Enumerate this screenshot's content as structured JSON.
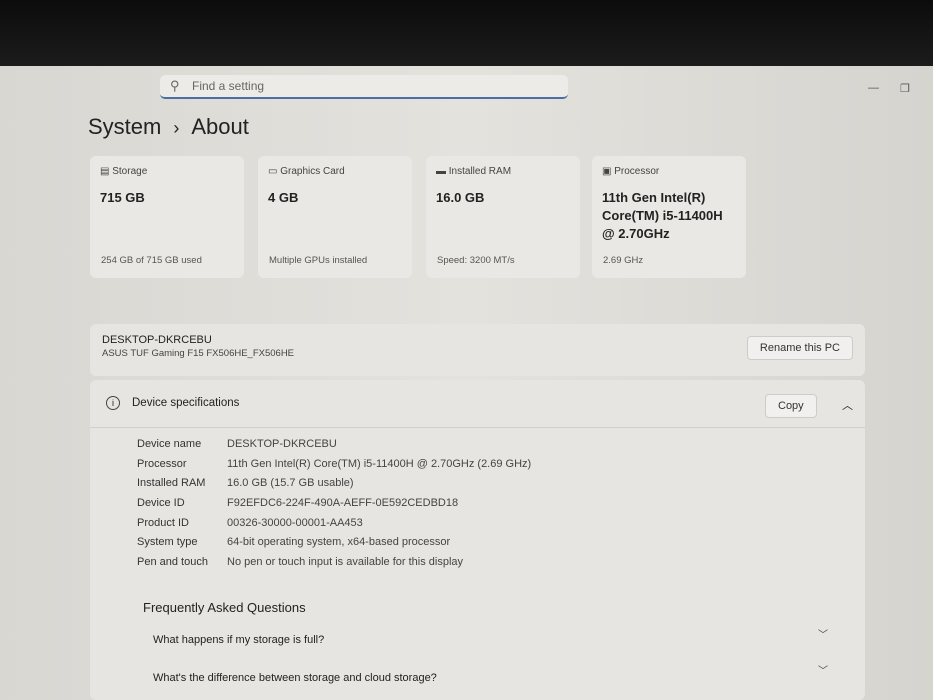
{
  "search": {
    "placeholder": "Find a setting"
  },
  "breadcrumb": {
    "parent": "System",
    "separator": "›",
    "current": "About"
  },
  "cards": [
    {
      "label": "Storage",
      "value": "715 GB",
      "sub": "254 GB of 715 GB used",
      "icon": "storage-icon"
    },
    {
      "label": "Graphics Card",
      "value": "4 GB",
      "sub": "Multiple GPUs installed",
      "icon": "gpu-icon"
    },
    {
      "label": "Installed RAM",
      "value": "16.0 GB",
      "sub": "Speed: 3200 MT/s",
      "icon": "ram-icon"
    },
    {
      "label": "Processor",
      "value": "11th Gen Intel(R) Core(TM) i5-11400H @ 2.70GHz",
      "sub": "2.69 GHz",
      "icon": "cpu-icon"
    }
  ],
  "pc": {
    "name": "DESKTOP-DKRCEBU",
    "model": "ASUS TUF Gaming F15 FX506HE_FX506HE",
    "rename": "Rename this PC"
  },
  "specs": {
    "title": "Device specifications",
    "copy": "Copy",
    "rows": [
      {
        "k": "Device name",
        "v": "DESKTOP-DKRCEBU"
      },
      {
        "k": "Processor",
        "v": "11th Gen Intel(R) Core(TM) i5-11400H @ 2.70GHz (2.69 GHz)"
      },
      {
        "k": "Installed RAM",
        "v": "16.0 GB (15.7 GB usable)"
      },
      {
        "k": "Device ID",
        "v": "F92EFDC6-224F-490A-AEFF-0E592CEDBD18"
      },
      {
        "k": "Product ID",
        "v": "00326-30000-00001-AA453"
      },
      {
        "k": "System type",
        "v": "64-bit operating system, x64-based processor"
      },
      {
        "k": "Pen and touch",
        "v": "No pen or touch input is available for this display"
      }
    ]
  },
  "faq": {
    "title": "Frequently Asked Questions",
    "items": [
      "What happens if my storage is full?",
      "What's the difference between storage and cloud storage?"
    ]
  }
}
